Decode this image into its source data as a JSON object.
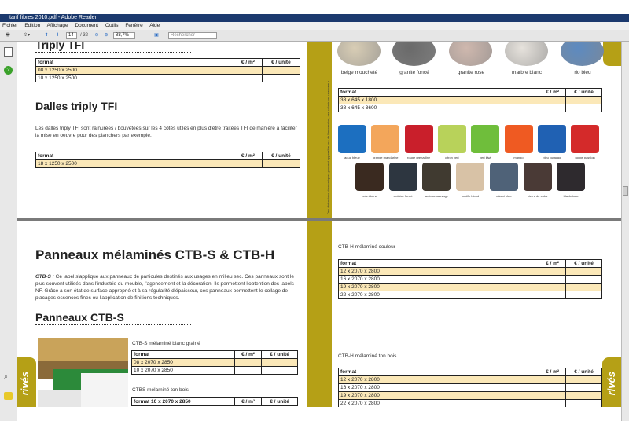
{
  "window": {
    "title": "tarif fibres 2010.pdf - Adobe Reader"
  },
  "menu": [
    "Fichier",
    "Edition",
    "Affichage",
    "Document",
    "Outils",
    "Fenêtre",
    "Aide"
  ],
  "toolbar": {
    "page_current": "14",
    "page_total": "/ 32",
    "zoom": "88,7%",
    "search_placeholder": "Rechercher"
  },
  "page1": {
    "title_triply": "Triply TFI",
    "table1": {
      "headers": [
        "format",
        "€ / m²",
        "€ / unité"
      ],
      "rows": [
        "08 x 1250 x 2500",
        "10 x 1250 x 2500"
      ]
    },
    "title_dalles": "Dalles triply TFI",
    "dalles_text": "Les dalles triply TFI sont rainurées / bouvetées sur les 4 côtés utiles en plus d'être traitées TFI de manière à faciliter la mise en oeuvre pour des planchers par exemple.",
    "table2": {
      "headers": [
        "format",
        "€ / m²",
        "€ / unité"
      ],
      "rows": [
        "18 x 1250 x 2500"
      ]
    }
  },
  "page2": {
    "stones": [
      "beige moucheté",
      "granite foncé",
      "granite rose",
      "marbre blanc",
      "rio bleu"
    ],
    "table": {
      "headers": [
        "format",
        "€ / m²",
        "€ / unité"
      ],
      "rows": [
        "38 x 645 x 1800",
        "38 x 645 x 3600"
      ]
    },
    "side_text": "Des distorsions chromatiques peuvent apparaître lors de l'impression, ces coloris ont une valeur",
    "colors_row1": [
      "aqua bleue",
      "orange mandarine",
      "rouge grenadine",
      "citron vert",
      "vert kiwi",
      "mango",
      "bleu curaçao",
      "rouge passion"
    ],
    "colors_row2": [
      "bois ébène",
      "ardoise foncé",
      "ardoise sauvage",
      "pacific blond",
      "miami bleu",
      "pierre de cuba",
      "blackstone"
    ]
  },
  "page3": {
    "title_main": "Panneaux mélaminés CTB-S & CTB-H",
    "intro_label": "CTB-S :",
    "intro_text": " Ce label s'applique aux panneaux de particules destinés aux usages en milieu sec. Ces panneaux sont le plus souvent utilisés dans l'industrie du meuble, l'agencement et la décoration. Ils permettent l'obtention des labels NF. Grâce à son état de surface approprié et à sa régularité d'épaisseur, ces panneaux permettent le collage de placages essences fines ou l'application de finitions techniques.",
    "title_ctbs": "Panneaux CTB-S",
    "ctbs_label1": "CTB-S mélaminé blanc grainé",
    "table1": {
      "headers": [
        "format",
        "€ / m²",
        "€ / unité"
      ],
      "rows": [
        "08 x 2070 x 2850",
        "10 x 2070 x 2850"
      ]
    },
    "ctbs_label2": "CTBS mélaminé ton bois",
    "table2": {
      "headers": [
        "format 10 x 2070 x 2850",
        "€ / m²",
        "€ / unité"
      ],
      "rows": []
    },
    "side_tab": "rivés"
  },
  "page4": {
    "label1": "CTB-H mélaminé couleur",
    "table1": {
      "headers": [
        "format",
        "€ / m²",
        "€ / unité"
      ],
      "rows": [
        "12 x 2070 x 2800",
        "16 x 2070 x 2800",
        "19 x 2070 x 2800",
        "22 x 2070 x 2800"
      ]
    },
    "label2": "CTB-H mélaminé ton bois",
    "table2": {
      "headers": [
        "format",
        "€ / m²",
        "€ / unité"
      ],
      "rows": [
        "12 x 2070 x 2800",
        "16 x 2070 x 2800",
        "19 x 2070 x 2800",
        "22 x 2070 x 2800"
      ]
    },
    "side_tab": "rivés"
  },
  "colors": {
    "olive": "#b5a016",
    "highlight": "#fbe8b8",
    "row1": [
      "#1c6fc0",
      "#f3a65b",
      "#c91f2b",
      "#b8d25a",
      "#6fbe3b",
      "#ef5a22",
      "#2061b3",
      "#d42a2a"
    ],
    "row2": [
      "#3a2a20",
      "#2d3640",
      "#403a30",
      "#d8c2a6",
      "#4f6278",
      "#4a3a36",
      "#2e2a2e"
    ],
    "stones": [
      "#d8cdb5",
      "#6a6a6a",
      "#cfb8ae",
      "#e6e2dc",
      "#5d8ac0"
    ]
  }
}
